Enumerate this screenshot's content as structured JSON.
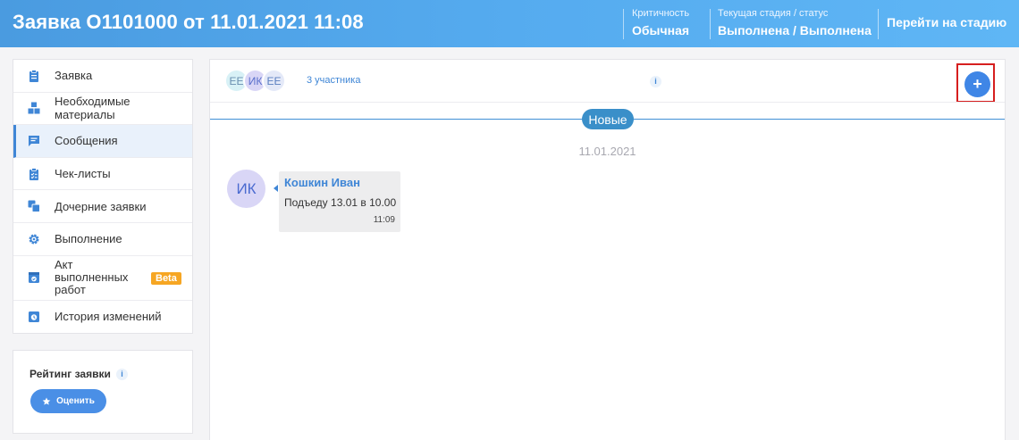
{
  "header": {
    "title": "Заявка О1101000 от 11.01.2021 11:08",
    "criticality_label": "Критичность",
    "criticality_value": "Обычная",
    "stage_label": "Текущая стадия / статус",
    "stage_value": "Выполнена / Выполнена",
    "goto_stage_button": "Перейти на стадию"
  },
  "sidebar": {
    "items": [
      {
        "label": "Заявка",
        "icon": "clipboard-icon"
      },
      {
        "label": "Необходимые материалы",
        "icon": "boxes-icon"
      },
      {
        "label": "Сообщения",
        "icon": "chat-icon",
        "active": true
      },
      {
        "label": "Чек-листы",
        "icon": "checklist-icon"
      },
      {
        "label": "Дочерние заявки",
        "icon": "child-requests-icon"
      },
      {
        "label": "Выполнение",
        "icon": "gear-icon"
      },
      {
        "label": "Акт выполненных работ",
        "icon": "act-icon",
        "badge": "Beta"
      },
      {
        "label": "История изменений",
        "icon": "history-icon"
      }
    ]
  },
  "rating": {
    "title": "Рейтинг заявки",
    "info": "i",
    "button_label": "Оценить"
  },
  "chat": {
    "participants": [
      {
        "initials": "ЕЕ",
        "bg": "#d8f1f6",
        "fg": "#6a8fb0"
      },
      {
        "initials": "ИК",
        "bg": "#d9d6f6",
        "fg": "#5a6fcc"
      },
      {
        "initials": "ЕЕ",
        "bg": "#e4e9f8",
        "fg": "#5a7fc0"
      }
    ],
    "participants_count": "3 участника",
    "info": "i",
    "add_button": "+",
    "new_marker": "Новые",
    "date_separator": "11.01.2021",
    "messages": [
      {
        "avatar": "ИК",
        "author": "Кошкин Иван",
        "text": "Подъеду 13.01 в 10.00",
        "time": "11:09"
      }
    ]
  },
  "colors": {
    "header_gradient_start": "#4a9be0",
    "header_gradient_end": "#5fb6f5",
    "accent": "#3f86d6",
    "beta_badge": "#f6a623",
    "new_marker": "#3a8fc9",
    "highlight_frame": "#d61f1f"
  }
}
